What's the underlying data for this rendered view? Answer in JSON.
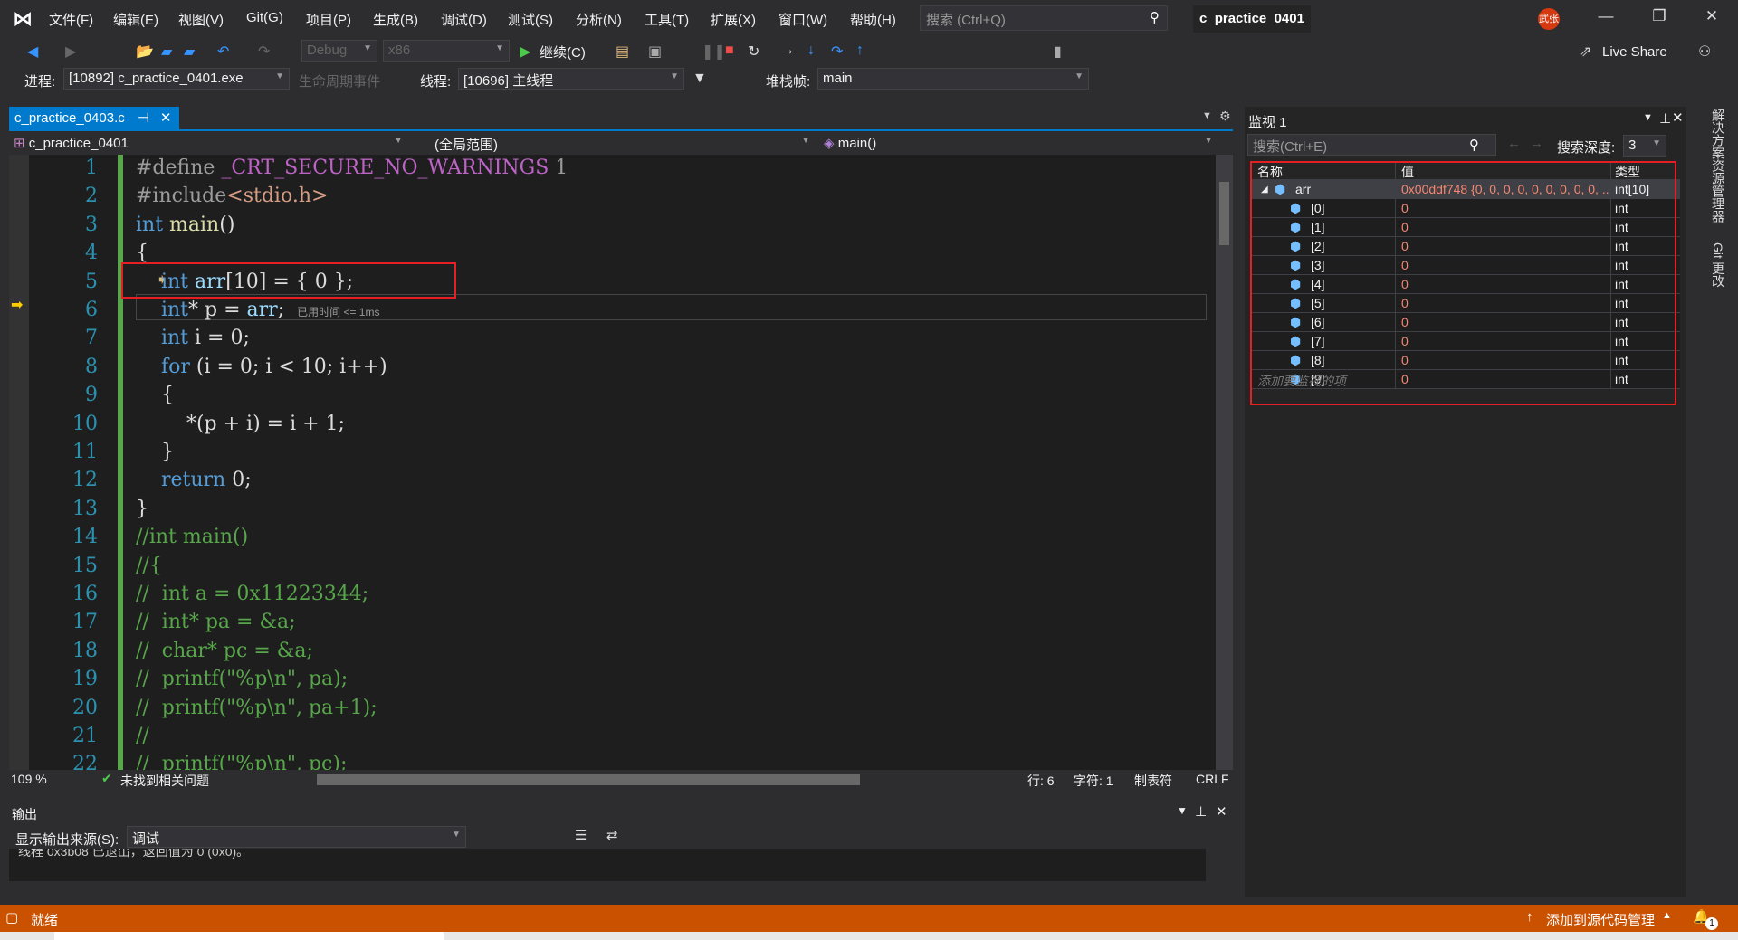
{
  "menu": {
    "items": [
      "文件(F)",
      "编辑(E)",
      "视图(V)",
      "Git(G)",
      "项目(P)",
      "生成(B)",
      "调试(D)",
      "测试(S)",
      "分析(N)",
      "工具(T)",
      "扩展(X)",
      "窗口(W)",
      "帮助(H)"
    ],
    "search_placeholder": "搜索 (Ctrl+Q)",
    "window_title": "c_practice_0401",
    "avatar": "武张"
  },
  "toolbar": {
    "config": "Debug",
    "platform": "x86",
    "continue": "继续(C)",
    "live_share": "Live Share"
  },
  "debugbar": {
    "process_label": "进程:",
    "process": "[10892] c_practice_0401.exe",
    "lifecycle": "生命周期事件",
    "thread_label": "线程:",
    "thread": "[10696] 主线程",
    "stack_label": "堆栈帧:",
    "stack": "main"
  },
  "editor": {
    "tab": "c_practice_0403.c",
    "nav_project": "c_practice_0401",
    "nav_scope": "(全局范围)",
    "nav_func": "main()",
    "hint": "已用时间 <= 1ms",
    "lines": [
      [
        [
          "#define ",
          "pp"
        ],
        [
          "_CRT_SECURE_NO_WARNINGS",
          "mac"
        ],
        [
          " 1",
          "pp"
        ]
      ],
      [
        [
          "#include",
          "pp"
        ],
        [
          "<stdio.h>",
          "str"
        ]
      ],
      [
        [
          "int",
          "kw"
        ],
        [
          " main",
          "fn"
        ],
        [
          "()",
          "plain"
        ]
      ],
      [
        [
          "{",
          "plain"
        ]
      ],
      [
        [
          "    int",
          "kw"
        ],
        [
          " arr",
          "var"
        ],
        [
          "[10] = { 0 };",
          "plain"
        ]
      ],
      [
        [
          "    int",
          "kw"
        ],
        [
          "* p = ",
          "plain"
        ],
        [
          "arr",
          "var"
        ],
        [
          ";",
          "plain"
        ]
      ],
      [
        [
          "    int",
          "kw"
        ],
        [
          " i = 0;",
          "plain"
        ]
      ],
      [
        [
          "    for",
          "kw"
        ],
        [
          " (i = 0; i < 10; i++)",
          "plain"
        ]
      ],
      [
        [
          "    {",
          "plain"
        ]
      ],
      [
        [
          "        *(p + i) = i + 1;",
          "plain"
        ]
      ],
      [
        [
          "    }",
          "plain"
        ]
      ],
      [
        [
          "    return",
          "kw"
        ],
        [
          " 0;",
          "plain"
        ]
      ],
      [
        [
          "}",
          "plain"
        ]
      ],
      [
        [
          "//int main()",
          "cm"
        ]
      ],
      [
        [
          "//{",
          "cm"
        ]
      ],
      [
        [
          "//  int a = 0x11223344;",
          "cm"
        ]
      ],
      [
        [
          "//  int* pa = &a;",
          "cm"
        ]
      ],
      [
        [
          "//  char* pc = &a;",
          "cm"
        ]
      ],
      [
        [
          "//  printf(\"%p\\n\", pa);",
          "cm"
        ]
      ],
      [
        [
          "//  printf(\"%p\\n\", pa+1);",
          "cm"
        ]
      ],
      [
        [
          "//",
          "cm"
        ]
      ],
      [
        [
          "//  printf(\"%p\\n\", pc);",
          "cm"
        ]
      ]
    ],
    "zoom": "109 %",
    "issues": "未找到相关问题",
    "row": "行: 6",
    "col": "字符: 1",
    "tabs": "制表符",
    "eol": "CRLF"
  },
  "output": {
    "title": "输出",
    "source_label": "显示输出来源(S):",
    "source": "调试",
    "text": "线程 0x3b08 已退出，返回值为 0 (0x0)。"
  },
  "watch": {
    "title": "监视 1",
    "search_placeholder": "搜索(Ctrl+E)",
    "depth_label": "搜索深度:",
    "depth": "3",
    "headers": [
      "名称",
      "值",
      "类型"
    ],
    "root": {
      "name": "arr",
      "value": "0x00ddf748 {0, 0, 0, 0, 0, 0, 0, 0, 0, ...",
      "type": "int[10]"
    },
    "items": [
      {
        "name": "[0]",
        "value": "0",
        "type": "int"
      },
      {
        "name": "[1]",
        "value": "0",
        "type": "int"
      },
      {
        "name": "[2]",
        "value": "0",
        "type": "int"
      },
      {
        "name": "[3]",
        "value": "0",
        "type": "int"
      },
      {
        "name": "[4]",
        "value": "0",
        "type": "int"
      },
      {
        "name": "[5]",
        "value": "0",
        "type": "int"
      },
      {
        "name": "[6]",
        "value": "0",
        "type": "int"
      },
      {
        "name": "[7]",
        "value": "0",
        "type": "int"
      },
      {
        "name": "[8]",
        "value": "0",
        "type": "int"
      },
      {
        "name": "[9]",
        "value": "0",
        "type": "int"
      }
    ],
    "add_placeholder": "添加要监视的项"
  },
  "side_tabs": [
    "解决方案资源管理器",
    "Git 更改"
  ],
  "status": {
    "ready": "就绪",
    "source_control": "添加到源代码管理",
    "notifications": "1"
  },
  "colors": {
    "accent": "#007acc",
    "status": "#ca5100",
    "highlight": "#e51f24",
    "changed_value": "#f48771"
  }
}
